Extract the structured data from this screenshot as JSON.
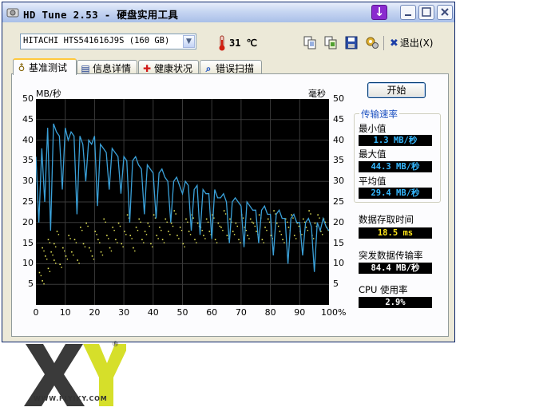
{
  "window": {
    "title": "HD Tune 2.53 - 硬盘实用工具",
    "drive": "HITACHI HTS541616J9S (160 GB)",
    "temperature": "31 ℃",
    "exit_label": "退出(X)",
    "minimize_icon": "minimize-icon",
    "maximize_icon": "maximize-icon",
    "close_icon": "close-icon"
  },
  "tabs": [
    {
      "label": "基准测试",
      "icon": "benchmark-icon",
      "active": true
    },
    {
      "label": "信息详情",
      "icon": "info-icon",
      "active": false
    },
    {
      "label": "健康状况",
      "icon": "health-cross-icon",
      "active": false
    },
    {
      "label": "错误扫描",
      "icon": "magnifier-icon",
      "active": false
    }
  ],
  "toolbar_icons": [
    "copy-text-icon",
    "copy-screenshot-icon",
    "save-icon",
    "options-icon"
  ],
  "start_button": "开始",
  "stats": {
    "group_title": "传输速率",
    "min_label": "最小值",
    "min_value": "1.3 MB/秒",
    "max_label": "最大值",
    "max_value": "44.3 MB/秒",
    "avg_label": "平均值",
    "avg_value": "29.4 MB/秒",
    "access_label": "数据存取时间",
    "access_value": "18.5 ms",
    "burst_label": "突发数据传输率",
    "burst_value": "84.4 MB/秒",
    "cpu_label": "CPU 使用率",
    "cpu_value": "2.9%"
  },
  "colors": {
    "chart_background": "#000000",
    "transfer_line": "#3aa0d8",
    "access_dots": "#e8e85a",
    "grid": "#3a3a3a",
    "lcd_blue": "#35b8ff",
    "lcd_yellow": "#ffe61a"
  },
  "chart_data": {
    "type": "line",
    "left_unit": "MB/秒",
    "right_unit": "毫秒",
    "y_ticks": [
      "5",
      "10",
      "15",
      "20",
      "25",
      "30",
      "35",
      "40",
      "45",
      "50"
    ],
    "x_ticks": [
      "0",
      "10",
      "20",
      "30",
      "40",
      "50",
      "60",
      "70",
      "80",
      "90",
      "100%"
    ],
    "xlim": [
      0,
      100
    ],
    "ylim": [
      0,
      50
    ],
    "grid": true,
    "series": [
      {
        "style": "line",
        "x": [
          0,
          1,
          2,
          3,
          4,
          5,
          6,
          7,
          8,
          9,
          10,
          11,
          12,
          13,
          14,
          15,
          16,
          17,
          18,
          19,
          20,
          21,
          22,
          23,
          24,
          25,
          26,
          27,
          28,
          29,
          30,
          31,
          32,
          33,
          34,
          35,
          36,
          37,
          38,
          39,
          40,
          41,
          42,
          43,
          44,
          45,
          46,
          47,
          48,
          49,
          50,
          51,
          52,
          53,
          54,
          55,
          56,
          57,
          58,
          59,
          60,
          61,
          62,
          63,
          64,
          65,
          66,
          67,
          68,
          69,
          70,
          71,
          72,
          73,
          74,
          75,
          76,
          77,
          78,
          79,
          80,
          81,
          82,
          83,
          84,
          85,
          86,
          87,
          88,
          89,
          90,
          91,
          92,
          93,
          94,
          95,
          96,
          97,
          98,
          99,
          100
        ],
        "y": [
          36,
          20,
          38,
          25,
          43,
          18,
          44,
          42,
          41,
          28,
          43,
          40,
          42,
          41,
          22,
          41,
          39,
          30,
          40,
          39,
          41,
          24,
          39,
          38,
          37,
          28,
          38,
          37,
          36,
          27,
          36,
          35,
          20,
          35,
          36,
          34,
          33,
          22,
          34,
          33,
          32,
          21,
          32,
          33,
          31,
          30,
          20,
          30,
          31,
          29,
          27,
          30,
          29,
          18,
          28,
          29,
          17,
          28,
          27,
          27,
          16,
          28,
          26,
          26,
          27,
          25,
          15,
          25,
          26,
          25,
          24,
          14,
          25,
          24,
          23,
          23,
          15,
          23,
          24,
          22,
          22,
          12,
          22,
          23,
          21,
          21,
          10,
          21,
          22,
          20,
          20,
          12,
          20,
          21,
          19,
          8,
          20,
          18,
          21,
          19,
          18
        ]
      },
      {
        "style": "scatter",
        "x": [
          1,
          2,
          2,
          3,
          4,
          4,
          5,
          6,
          6,
          7,
          8,
          9,
          10,
          11,
          12,
          13,
          14,
          15,
          16,
          17,
          18,
          19,
          20,
          21,
          22,
          23,
          24,
          25,
          26,
          27,
          28,
          29,
          30,
          31,
          32,
          33,
          34,
          35,
          36,
          37,
          38,
          39,
          40,
          41,
          42,
          43,
          44,
          45,
          46,
          47,
          48,
          49,
          50,
          51,
          52,
          53,
          54,
          55,
          56,
          57,
          58,
          59,
          60,
          61,
          62,
          63,
          64,
          65,
          66,
          67,
          68,
          69,
          70,
          71,
          72,
          73,
          74,
          75,
          76,
          77,
          78,
          79,
          80,
          81,
          82,
          83,
          84,
          85,
          86,
          87,
          88,
          89,
          90,
          91,
          92,
          93,
          94,
          95,
          96,
          97,
          98,
          99
        ],
        "y": [
          8,
          14,
          6,
          12,
          16,
          9,
          13,
          11,
          15,
          18,
          10,
          14,
          12,
          17,
          13,
          16,
          11,
          19,
          15,
          20,
          14,
          12,
          18,
          16,
          13,
          21,
          17,
          14,
          19,
          16,
          20,
          15,
          18,
          22,
          17,
          14,
          19,
          21,
          16,
          18,
          20,
          15,
          22,
          17,
          19,
          16,
          21,
          18,
          20,
          23,
          17,
          19,
          15,
          21,
          18,
          22,
          16,
          20,
          19,
          17,
          21,
          18,
          22,
          16,
          20,
          19,
          23,
          17,
          21,
          18,
          20,
          16,
          22,
          19,
          17,
          21,
          20,
          18,
          22,
          16,
          19,
          21,
          17,
          23,
          20,
          18,
          16,
          21,
          19,
          22,
          17,
          20,
          18,
          21,
          19,
          23,
          17,
          20,
          22,
          18,
          21,
          19
        ]
      }
    ]
  }
}
